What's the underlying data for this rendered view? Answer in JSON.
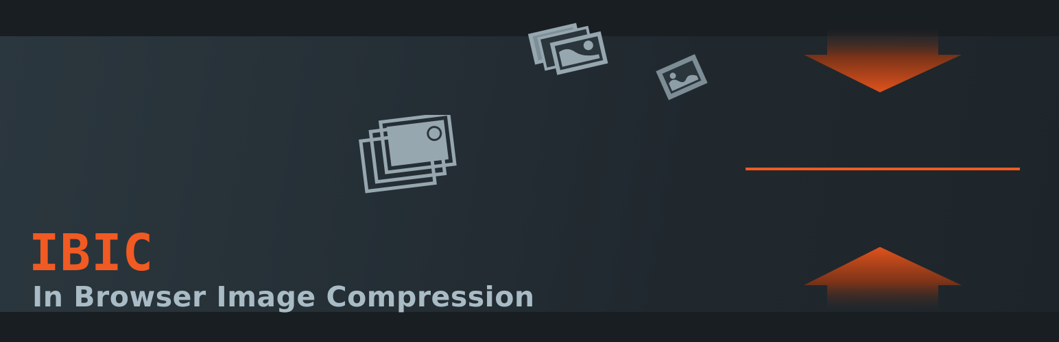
{
  "banner": {
    "title": "IBIC",
    "subtitle": "In Browser Image Compression"
  },
  "icons": {
    "large_stack": "image-stack-icon",
    "small_stack": "image-stack-icon",
    "single_image": "image-icon",
    "arrow_down": "arrow-down-icon",
    "arrow_up": "arrow-up-icon",
    "divider": "compression-line"
  },
  "colors": {
    "accent": "#f15a22",
    "text_light": "#a9bcc6",
    "icon_gray": "#97a7af",
    "background": "#252f36"
  }
}
